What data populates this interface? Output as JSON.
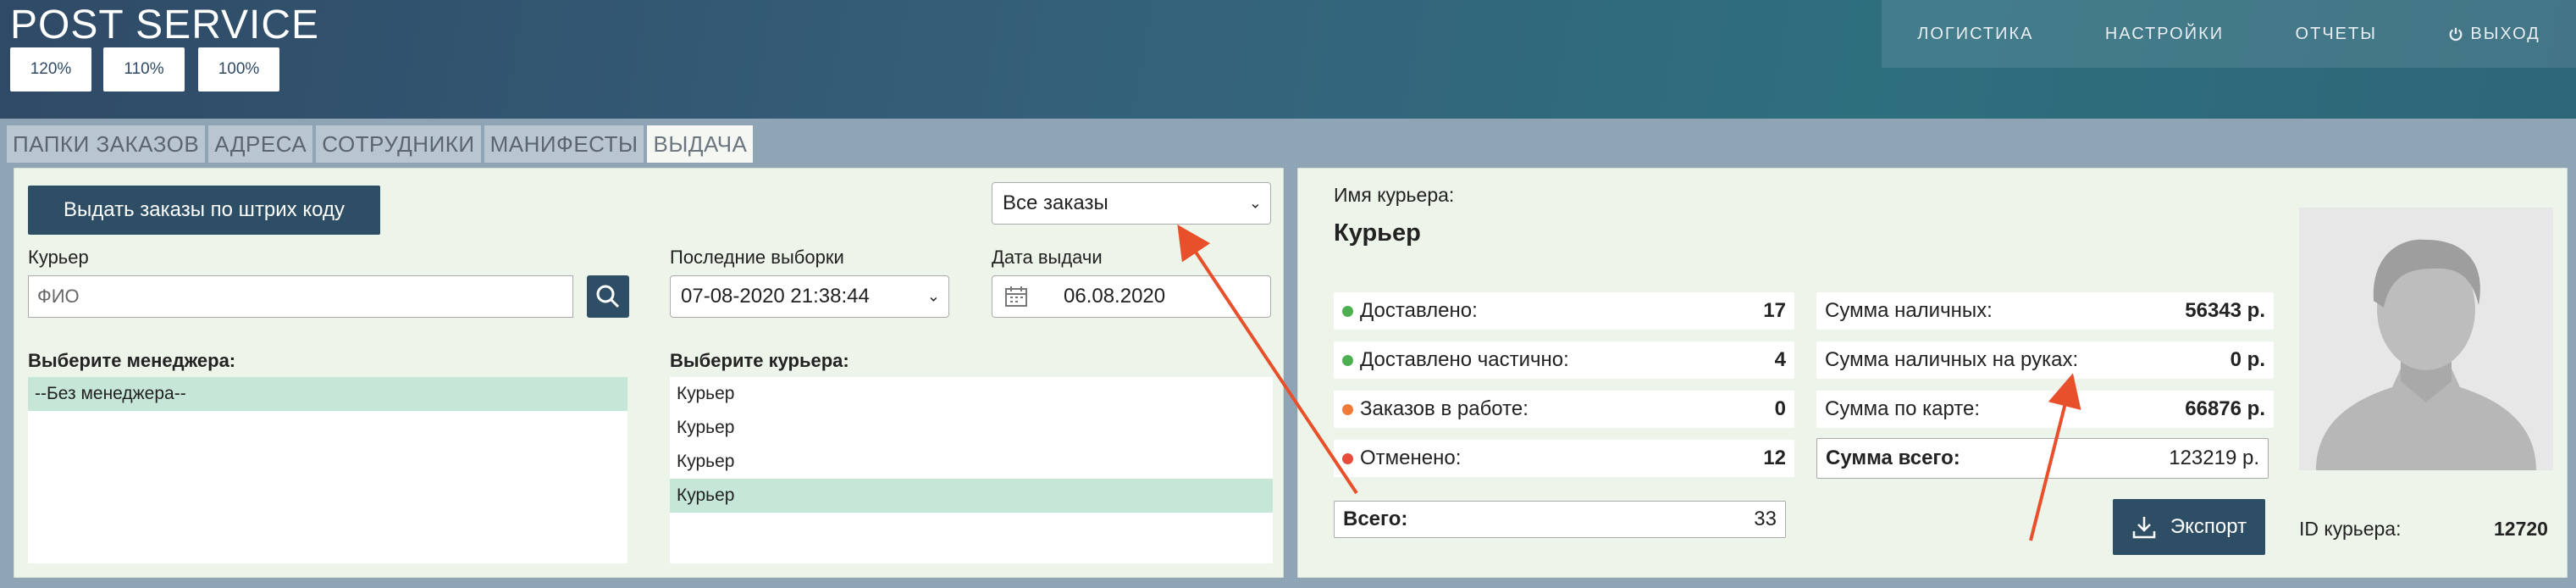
{
  "app": {
    "title": "POST SERVICE"
  },
  "zoom": {
    "z120": "120%",
    "z110": "110%",
    "z100": "100%"
  },
  "topnav": {
    "logistics": "ЛОГИСТИКА",
    "settings": "НАСТРОЙКИ",
    "reports": "ОТЧЕТЫ",
    "logout": "ВЫХОД"
  },
  "tabs": [
    "ПАПКИ ЗАКАЗОВ",
    "АДРЕСА",
    "СОТРУДНИКИ",
    "МАНИФЕСТЫ",
    "ВЫДАЧА"
  ],
  "left": {
    "barcode_button": "Выдать заказы по штрих коду",
    "orders_filter": "Все заказы",
    "courier_label": "Курьер",
    "courier_placeholder": "ФИО",
    "last_selections_label": "Последние выборки",
    "last_selection_value": "07-08-2020 21:38:44",
    "issue_date_label": "Дата выдачи",
    "issue_date_value": "06.08.2020",
    "manager_label": "Выберите менеджера:",
    "managers": [
      "--Без менеджера--"
    ],
    "courier_select_label": "Выберите курьера:",
    "couriers": [
      "Курьер",
      "Курьер",
      "Курьер",
      "Курьер"
    ]
  },
  "right": {
    "courier_name_label": "Имя курьера:",
    "courier_name": "Курьер",
    "stats": {
      "delivered_label": "Доставлено:",
      "delivered": "17",
      "partial_label": "Доставлено частично:",
      "partial": "4",
      "in_work_label": "Заказов в работе:",
      "in_work": "0",
      "cancelled_label": "Отменено:",
      "cancelled": "12",
      "total_label": "Всего:",
      "total": "33"
    },
    "sums": {
      "cash_label": "Сумма наличных:",
      "cash": "56343 р.",
      "cash_hand_label": "Сумма наличных на руках:",
      "cash_hand": "0 р.",
      "card_label": "Сумма по карте:",
      "card": "66876 р.",
      "all_label": "Сумма всего:",
      "all": "123219 р."
    },
    "export_button": "Экспорт",
    "courier_id_label": "ID курьера:",
    "courier_id": "12720"
  },
  "colors": {
    "primary": "#2e4e66",
    "green_dot": "#4caf50",
    "orange_dot": "#f07a3a",
    "red_dot": "#e74c3c",
    "arrow": "#e8502c"
  },
  "icons": [
    "search-icon",
    "calendar-icon",
    "chevron-down-icon",
    "power-icon",
    "download-icon",
    "avatar-icon"
  ]
}
